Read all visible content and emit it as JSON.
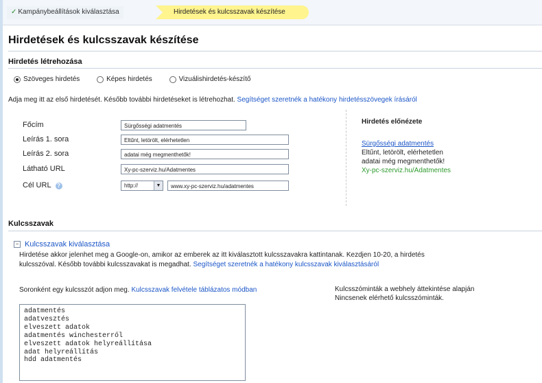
{
  "steps": {
    "step1_label": "Kampánybeállítások kiválasztása",
    "step2_label": "Hirdetések és kulcsszavak készítése"
  },
  "page_title": "Hirdetések és kulcsszavak készítése",
  "ad_section": {
    "title": "Hirdetés létrehozása",
    "radio_text": "Szöveges hirdetés",
    "radio_image": "Képes hirdetés",
    "radio_display": "Vizuálishirdetés-készítő",
    "selected": "text",
    "intro": "Adja meg itt az első hirdetését. Később további hirdetéseket is létrehozhat.",
    "intro_link": "Segítséget szeretnék a hatékony hirdetésszövegek írásáról"
  },
  "form": {
    "headline_label": "Főcím",
    "headline_value": "Sürgősségi adatmentés",
    "desc1_label": "Leírás 1. sora",
    "desc1_value": "Eltűnt, letörölt, elérhetetlen",
    "desc2_label": "Leírás 2. sora",
    "desc2_value": "adatai még megmenthetők!",
    "display_url_label": "Látható URL",
    "display_url_value": "Xy-pc-szerviz.hu/Adatmentes",
    "dest_url_label": "Cél URL",
    "protocol_value": "http://",
    "dest_url_value": "www.xy-pc-szerviz.hu/adatmentes"
  },
  "preview": {
    "title": "Hirdetés előnézete",
    "headline": "Sürgősségi adatmentés",
    "line1": "Eltűnt, letörölt, elérhetetlen",
    "line2": "adatai még megmenthetők!",
    "url": "Xy-pc-szerviz.hu/Adatmentes"
  },
  "keywords": {
    "section_title": "Kulcsszavak",
    "toggle_label": "Kulcsszavak kiválasztása",
    "desc_line1": "Hirdetése akkor jelenhet meg a Google-on, amikor az emberek az itt kiválasztott kulcsszavakra kattintanak. Kezdjen 10-20, a hirdetés",
    "desc_line2": "kulcsszóval. Később további kulcsszavakat is megadhat.",
    "desc_link": "Segítséget szeretnék a hatékony kulcsszavak kiválasztásáról",
    "entry_text": "Soronként egy kulcsszót adjon meg.",
    "entry_link": "Kulcsszavak felvétele táblázatos módban",
    "list": [
      "adatmentés",
      "adatvesztés",
      "elveszett adatok",
      "adatmentés winchesterről",
      "elveszett adatok helyreállítása",
      "adat helyreállítás",
      "hdd adatmentés"
    ],
    "suggestions_title": "Kulcsszóminták a webhely áttekintése alapján",
    "suggestions_none": "Nincsenek elérhető kulcsszóminták."
  }
}
